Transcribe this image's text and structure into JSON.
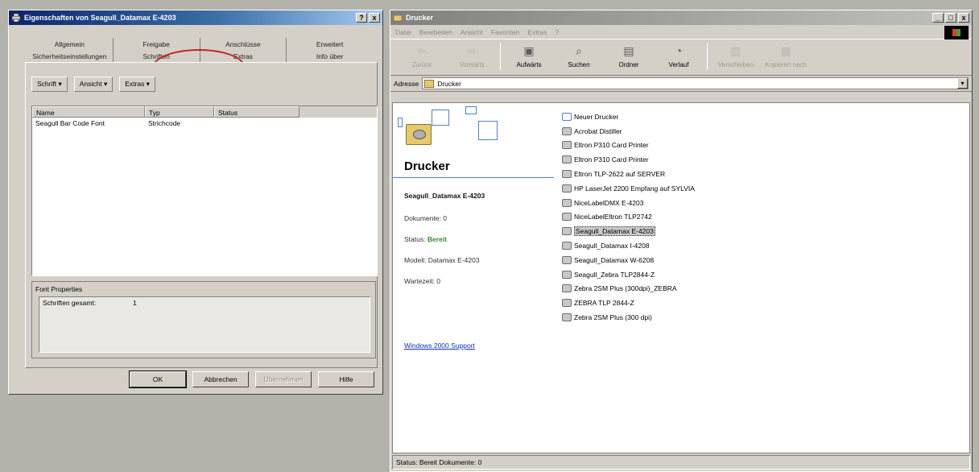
{
  "dialog": {
    "title": "Eigenschaften von Seagull_Datamax E-4203",
    "help_button": "?",
    "close_button": "x",
    "tabs_row1": [
      "Allgemein",
      "Freigabe",
      "Anschlüsse",
      "Erweitert"
    ],
    "tabs_row2": [
      "Sicherheitseinstellungen",
      "Schriften",
      "Extras",
      "Info über"
    ],
    "active_tab": "Schriften",
    "menu": [
      "Schrift ▾",
      "Ansicht ▾",
      "Extras ▾"
    ],
    "list": {
      "columns": [
        "Name",
        "Typ",
        "Status"
      ],
      "rows": [
        {
          "name": "Seagull Bar Code Font",
          "type": "Strichcode",
          "status": ""
        }
      ]
    },
    "font_properties": {
      "title": "Font Properties",
      "rows": [
        {
          "key": "Schriften gesamt:",
          "value": "1"
        }
      ]
    },
    "buttons": {
      "ok": "OK",
      "cancel": "Abbrechen",
      "apply": "Übernehmen",
      "help": "Hilfe"
    }
  },
  "explorer": {
    "title": "Drucker",
    "window_buttons": [
      "_",
      "□",
      "x"
    ],
    "menubar": [
      "Datei",
      "Bearbeiten",
      "Ansicht",
      "Favoriten",
      "Extras",
      "?"
    ],
    "toolbar": [
      {
        "label": "Zurück",
        "icon": "back-arrow-icon",
        "enabled": false
      },
      {
        "label": "Vorwärts",
        "icon": "forward-arrow-icon",
        "enabled": false
      },
      {
        "label": "Aufwärts",
        "icon": "up-folder-icon",
        "enabled": true
      },
      {
        "label": "Suchen",
        "icon": "search-icon",
        "enabled": true
      },
      {
        "label": "Ordner",
        "icon": "folders-icon",
        "enabled": true
      },
      {
        "label": "Verlauf",
        "icon": "history-icon",
        "enabled": true
      },
      {
        "label": "Verschieben",
        "icon": "move-to-icon",
        "enabled": false
      },
      {
        "label": "Kopieren nach",
        "icon": "copy-to-icon",
        "enabled": false
      }
    ],
    "address_label": "Adresse",
    "address_value": "Drucker",
    "left_panel": {
      "heading": "Drucker",
      "selected_name": "Seagull_Datamax E-4203",
      "documents": "Dokumente: 0",
      "status_label": "Status:",
      "status_value": "Bereit",
      "model": "Modell: Datamax E-4203",
      "queue": "Wartezeit: 0",
      "support_link": "Windows 2000 Support"
    },
    "printers": [
      {
        "label": "Neuer Drucker",
        "type": "new"
      },
      {
        "label": "Acrobat Distiller"
      },
      {
        "label": "Eltron P310 Card Printer"
      },
      {
        "label": "Eltron P310 Card Printer"
      },
      {
        "label": "Eltron TLP-2622 auf SERVER"
      },
      {
        "label": "HP LaserJet 2200 Empfang auf SYLVIA"
      },
      {
        "label": "NiceLabelDMX E-4203"
      },
      {
        "label": "NiceLabelEltron TLP2742"
      },
      {
        "label": "Seagull_Datamax E-4203",
        "selected": true
      },
      {
        "label": "Seagull_Datamax I-4208"
      },
      {
        "label": "Seagull_Datamax W-6208"
      },
      {
        "label": "Seagull_Zebra TLP2844-Z"
      },
      {
        "label": "Zebra 2SM Plus (300dpi)_ZEBRA"
      },
      {
        "label": "ZEBRA TLP 2844-Z"
      },
      {
        "label": "Zebra 2SM Plus (300 dpi)"
      }
    ],
    "statusbar": "Status: Bereit Dokumente: 0"
  }
}
